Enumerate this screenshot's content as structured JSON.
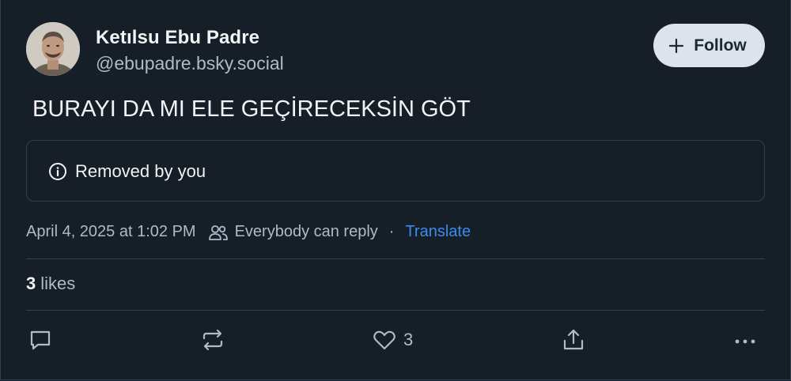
{
  "author": {
    "display_name": "Ketılsu Ebu Padre",
    "handle": "@ebupadre.bsky.social",
    "avatar_icon": "profile-photo"
  },
  "follow_button": {
    "icon": "plus-icon",
    "label": "Follow"
  },
  "post": {
    "text": "BURAYI DA MI ELE GEÇİRECEKSİN GÖT",
    "removed_notice": {
      "icon": "info-icon",
      "label": "Removed by you"
    }
  },
  "meta": {
    "timestamp": "April 4, 2025 at 1:02 PM",
    "reply_setting": "Everybody can reply",
    "separator": "·",
    "translate_label": "Translate"
  },
  "stats": {
    "likes_count": "3",
    "likes_label": "likes"
  },
  "actions": {
    "reply_icon": "reply-icon",
    "repost_icon": "repost-icon",
    "like_icon": "heart-icon",
    "like_count": "3",
    "share_icon": "share-icon",
    "more_icon": "more-icon"
  },
  "colors": {
    "background": "#161e27",
    "border": "#2e4052",
    "text_primary": "#f1f3f5",
    "text_secondary": "#aebbc9",
    "link": "#3b8cf0",
    "follow_button_bg": "#dde3ea"
  }
}
